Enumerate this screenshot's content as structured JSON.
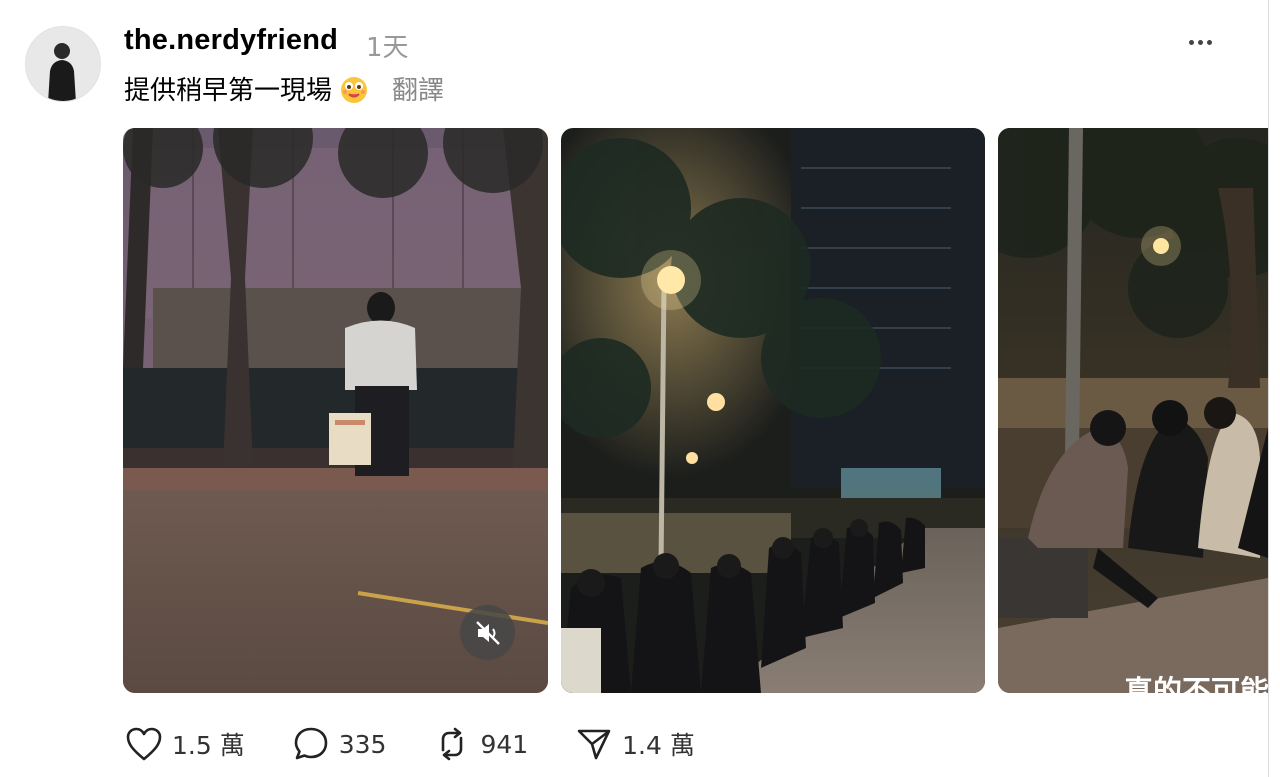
{
  "post": {
    "username": "the.nerdyfriend",
    "time": "1天",
    "caption": "提供稍早第一現場",
    "translate_label": "翻譯",
    "emoji_icon": "smiling-face-emoji-icon",
    "more_icon": "more-options-icon"
  },
  "media": {
    "count": 3,
    "mute_icon": "speaker-muted-icon",
    "overlay_text": "真的不可能"
  },
  "actions": {
    "likes": "1.5 萬",
    "comments": "335",
    "reposts": "941",
    "shares": "1.4 萬"
  },
  "colors": {
    "secondary_text": "#999999",
    "translate_text": "#888888",
    "mute_button_bg": "#464646"
  }
}
